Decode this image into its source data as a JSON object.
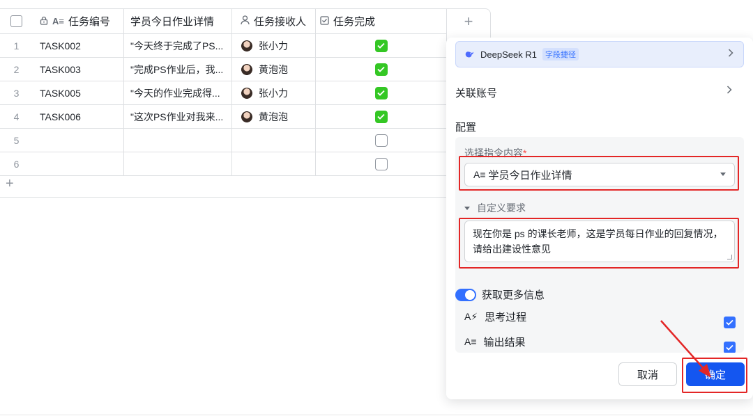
{
  "table": {
    "headers": [
      "任务编号",
      "学员今日作业详情",
      "任务接收人",
      "任务完成"
    ],
    "rows": [
      {
        "index": "1",
        "id": "TASK002",
        "detail": "\"今天终于完成了PS...",
        "receiver": "张小力",
        "done": true
      },
      {
        "index": "2",
        "id": "TASK003",
        "detail": "\"完成PS作业后，我...",
        "receiver": "黄泡泡",
        "done": true
      },
      {
        "index": "3",
        "id": "TASK005",
        "detail": "\"今天的作业完成得...",
        "receiver": "张小力",
        "done": true
      },
      {
        "index": "4",
        "id": "TASK006",
        "detail": "\"这次PS作业对我来...",
        "receiver": "黄泡泡",
        "done": true
      },
      {
        "index": "5",
        "id": "",
        "detail": "",
        "receiver": "",
        "done": false
      },
      {
        "index": "6",
        "id": "",
        "detail": "",
        "receiver": "",
        "done": false
      }
    ],
    "add_col_icon": "+",
    "add_row_icon": "+"
  },
  "panel": {
    "model_name": "DeepSeek R1",
    "model_tag": "字段捷径",
    "assoc_account": "关联账号",
    "config_label": "配置",
    "select_label": "选择指令内容",
    "required_mark": "*",
    "select_value": "学员今日作业详情",
    "custom_title": "自定义要求",
    "custom_text": "现在你是 ps 的课长老师，这是学员每日作业的回复情况，请给出建设性意见",
    "toggle_label": "获取更多信息",
    "toggle_on": true,
    "options": [
      {
        "label": "思考过程",
        "checked": true
      },
      {
        "label": "输出结果",
        "checked": true
      }
    ],
    "cancel_label": "取消",
    "ok_label": "确定"
  },
  "colors": {
    "accent": "#3370ff",
    "primary_button": "#1456f0",
    "green_check": "#34c724",
    "annotation_red": "#e32626"
  }
}
